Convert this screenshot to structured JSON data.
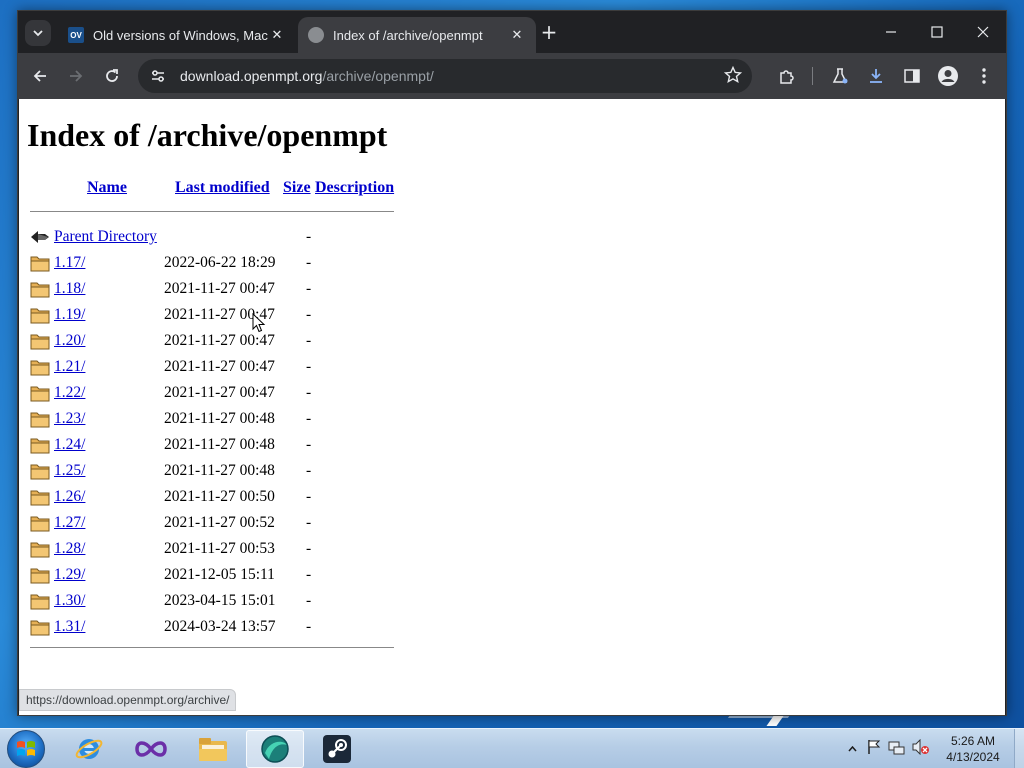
{
  "browser": {
    "tabs": [
      {
        "title": "Old versions of Windows, Mac",
        "favicon_text": "OV",
        "active": false
      },
      {
        "title": "Index of /archive/openmpt",
        "active": true
      }
    ],
    "url_host": "download.openmpt.org",
    "url_path": "/archive/openmpt/"
  },
  "page": {
    "heading": "Index of /archive/openmpt",
    "columns": {
      "name": "Name",
      "modified": "Last modified",
      "size": "Size",
      "description": "Description"
    },
    "parent": {
      "name": "Parent Directory",
      "size": "-"
    },
    "rows": [
      {
        "name": "1.17/",
        "date": "2022-06-22 18:29",
        "size": "-"
      },
      {
        "name": "1.18/",
        "date": "2021-11-27 00:47",
        "size": "-"
      },
      {
        "name": "1.19/",
        "date": "2021-11-27 00:47",
        "size": "-"
      },
      {
        "name": "1.20/",
        "date": "2021-11-27 00:47",
        "size": "-"
      },
      {
        "name": "1.21/",
        "date": "2021-11-27 00:47",
        "size": "-"
      },
      {
        "name": "1.22/",
        "date": "2021-11-27 00:47",
        "size": "-"
      },
      {
        "name": "1.23/",
        "date": "2021-11-27 00:48",
        "size": "-"
      },
      {
        "name": "1.24/",
        "date": "2021-11-27 00:48",
        "size": "-"
      },
      {
        "name": "1.25/",
        "date": "2021-11-27 00:48",
        "size": "-"
      },
      {
        "name": "1.26/",
        "date": "2021-11-27 00:50",
        "size": "-"
      },
      {
        "name": "1.27/",
        "date": "2021-11-27 00:52",
        "size": "-"
      },
      {
        "name": "1.28/",
        "date": "2021-11-27 00:53",
        "size": "-"
      },
      {
        "name": "1.29/",
        "date": "2021-12-05 15:11",
        "size": "-"
      },
      {
        "name": "1.30/",
        "date": "2023-04-15 15:01",
        "size": "-"
      },
      {
        "name": "1.31/",
        "date": "2024-03-24 13:57",
        "size": "-"
      }
    ]
  },
  "status_url": "https://download.openmpt.org/archive/",
  "taskbar": {
    "apps": [
      "internet-explorer-icon",
      "visual-studio-icon",
      "file-explorer-icon",
      "browser-icon",
      "steam-icon"
    ],
    "time": "5:26 AM",
    "date": "4/13/2024"
  },
  "colors": {
    "link": "#0000cc",
    "browser_dark": "#202124",
    "toolbar": "#3c3d41",
    "download_accent": "#8ab4f8"
  }
}
